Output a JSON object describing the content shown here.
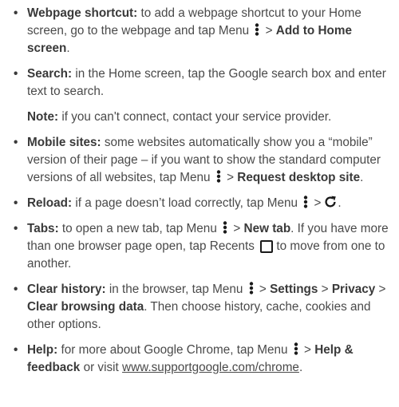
{
  "icons": {
    "menu": "menu-dots-vertical-icon",
    "reload": "reload-icon",
    "recents": "recents-square-icon"
  },
  "bullet": "•",
  "sep": ">",
  "items": {
    "shortcut": {
      "label": "Webpage shortcut:",
      "text1": " to add a webpage shortcut to your Home screen, go to the webpage and tap Menu ",
      "bold1": "Add to Home screen",
      "end": "."
    },
    "search": {
      "label": "Search:",
      "text1": " in the Home screen, tap the Google search box and enter text to search."
    },
    "note": {
      "label": "Note:",
      "text1": " if you can't connect, contact your service provider."
    },
    "mobile": {
      "label": "Mobile sites:",
      "text1": " some websites automatically show you a “mobile” version of their page – if you want to show the standard computer versions of all websites, tap Menu ",
      "bold1": "Request desktop site",
      "end": "."
    },
    "reload": {
      "label": "Reload:",
      "text1": " if a page doesn’t load correctly, tap Menu ",
      "end": "."
    },
    "tabs": {
      "label": "Tabs:",
      "text1": " to open a new tab, tap Menu ",
      "bold1": "New tab",
      "text2": ". If you have more than one browser page open, tap Recents ",
      "text3": " to move from one to another."
    },
    "clear": {
      "label": "Clear history:",
      "text1": " in the browser, tap Menu ",
      "bold1": "Settings",
      "bold2": "Privacy",
      "bold3": "Clear browsing data",
      "text2": ". Then choose history, cache, cookies and other options."
    },
    "help": {
      "label": "Help:",
      "text1": " for more about Google Chrome, tap Menu ",
      "bold1": "Help & feedback",
      "text2": " or visit ",
      "link": "www.supportgoogle.com/chrome",
      "end": "."
    }
  }
}
